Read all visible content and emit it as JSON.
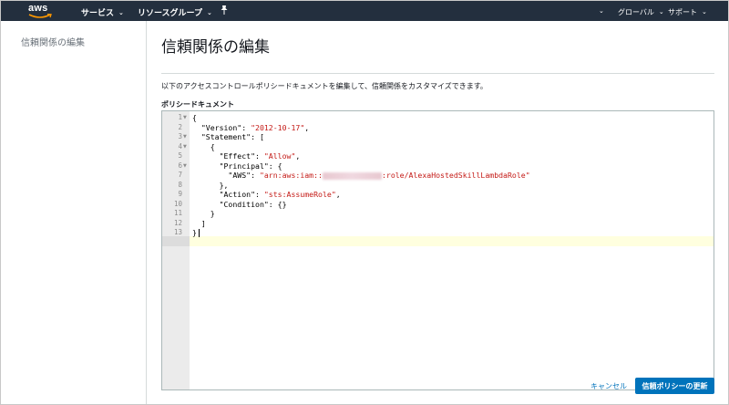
{
  "topnav": {
    "logo": "aws",
    "services": "サービス",
    "resource_groups": "リソースグループ",
    "pin_icon": "pin-icon",
    "user_chevron": "⌄",
    "region": "グローバル",
    "support": "サポート"
  },
  "sidebar": {
    "title": "信頼関係の編集"
  },
  "main": {
    "title": "信頼関係の編集",
    "description": "以下のアクセスコントロールポリシードキュメントを編集して、信頼関係をカスタマイズできます。",
    "doc_label": "ポリシードキュメント"
  },
  "editor": {
    "line_numbers": [
      "1",
      "2",
      "3",
      "4",
      "5",
      "6",
      "7",
      "8",
      "9",
      "10",
      "11",
      "12",
      "13"
    ],
    "lines": [
      {
        "pre": "{",
        "str": "",
        "post": ""
      },
      {
        "pre": "  \"Version\": ",
        "str": "\"2012-10-17\"",
        "post": ","
      },
      {
        "pre": "  \"Statement\": [",
        "str": "",
        "post": ""
      },
      {
        "pre": "    {",
        "str": "",
        "post": ""
      },
      {
        "pre": "      \"Effect\": ",
        "str": "\"Allow\"",
        "post": ","
      },
      {
        "pre": "      \"Principal\": {",
        "str": "",
        "post": ""
      },
      {
        "pre": "        \"AWS\": ",
        "str": "\"arn:aws:iam::",
        "post": ""
      },
      {
        "pre": "      },",
        "str": "",
        "post": ""
      },
      {
        "pre": "      \"Action\": ",
        "str": "\"sts:AssumeRole\"",
        "post": ","
      },
      {
        "pre": "      \"Condition\": {}",
        "str": "",
        "post": ""
      },
      {
        "pre": "    }",
        "str": "",
        "post": ""
      },
      {
        "pre": "  ]",
        "str": "",
        "post": ""
      },
      {
        "pre": "}",
        "str": "",
        "post": ""
      }
    ],
    "arn_suffix": ":role/AlexaHostedSkillLambdaRole\""
  },
  "actions": {
    "cancel": "キャンセル",
    "update": "信頼ポリシーの更新"
  },
  "colors": {
    "nav_bg": "#232f3e",
    "primary": "#0073bb",
    "string": "#c41a16",
    "active_line": "#ffffdf"
  }
}
